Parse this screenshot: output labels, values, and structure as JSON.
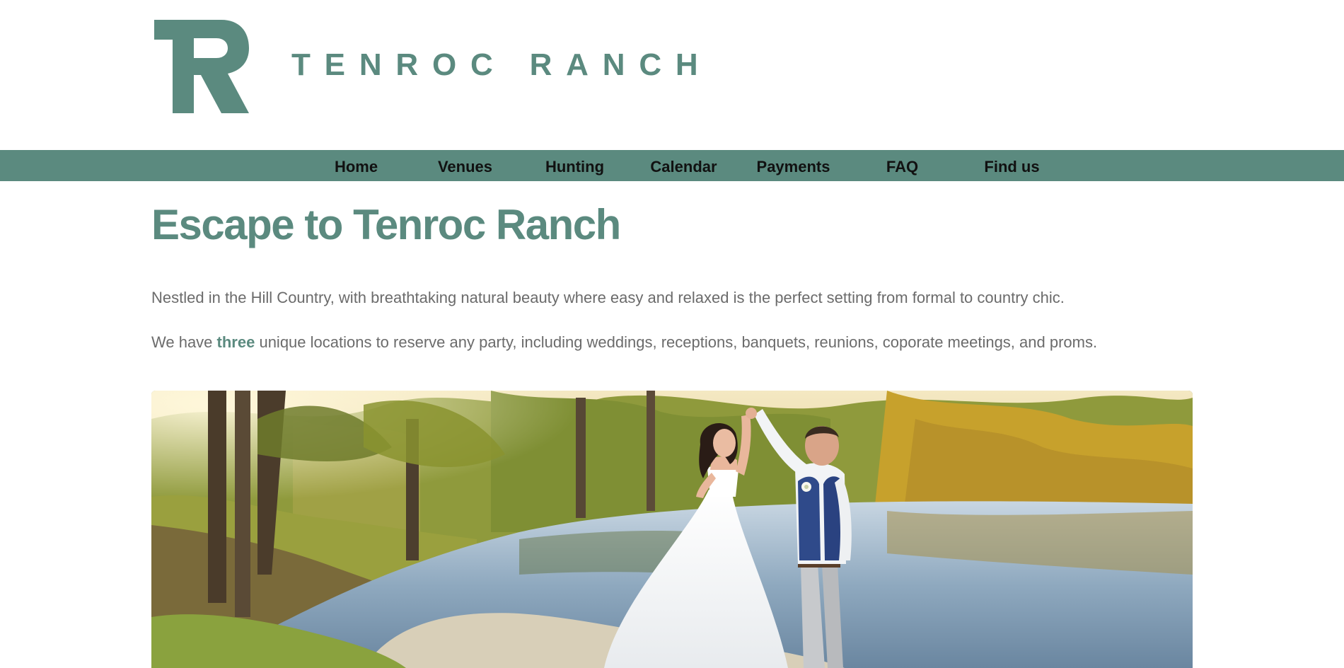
{
  "header": {
    "logo_icon": "r-monogram-logo",
    "site_name": "TENROC RANCH"
  },
  "nav": {
    "items": [
      {
        "label": "Home"
      },
      {
        "label": "Venues"
      },
      {
        "label": "Hunting"
      },
      {
        "label": "Calendar"
      },
      {
        "label": "Payments"
      },
      {
        "label": "FAQ"
      },
      {
        "label": "Find us"
      }
    ]
  },
  "main": {
    "title": "Escape to Tenroc Ranch",
    "intro": "Nestled in the Hill Country, with breathtaking natural beauty where easy and relaxed is the perfect setting from formal to country chic.",
    "locations_prefix": "We have ",
    "locations_count": "three",
    "locations_suffix": " unique locations to reserve any party, including weddings, receptions, banquets, reunions, coporate meetings, and proms."
  },
  "hero_image": {
    "subject": "wedding-couple-dancing-by-pond"
  },
  "colors": {
    "brand": "#5b8a7f",
    "body_text": "#6b6b6b",
    "nav_text": "#111111",
    "background": "#ffffff"
  }
}
